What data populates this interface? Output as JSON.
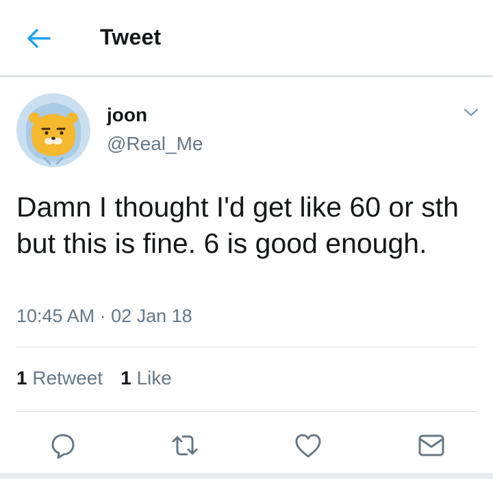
{
  "header": {
    "title": "Tweet"
  },
  "tweet": {
    "author_name": "joon",
    "author_handle": "@Real_Me",
    "text": "Damn I thought I'd get like 60 or sth but this is fine. 6 is good enough.",
    "timestamp": "10:45 AM · 02 Jan 18"
  },
  "stats": {
    "retweet_count": "1",
    "retweet_label": "Retweet",
    "like_count": "1",
    "like_label": "Like"
  },
  "icons": {
    "back": "arrow-left-icon",
    "caret": "chevron-down-icon",
    "reply": "reply-icon",
    "retweet": "retweet-icon",
    "like": "heart-icon",
    "message": "envelope-icon"
  },
  "colors": {
    "accent": "#1da1f2",
    "text": "#14171a",
    "muted": "#657786",
    "divider": "#d9dde1"
  }
}
